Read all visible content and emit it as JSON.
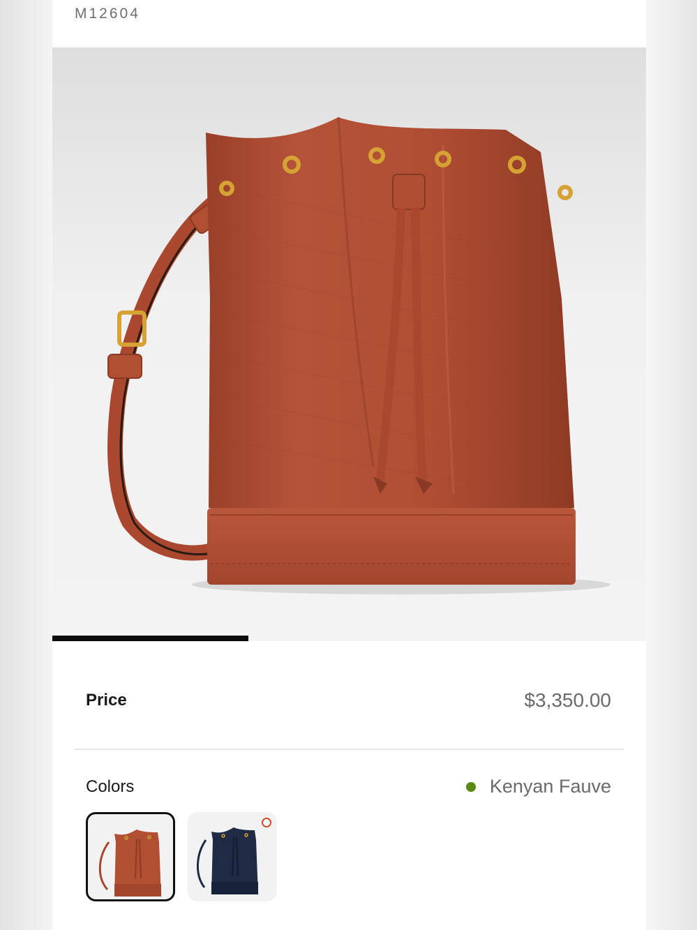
{
  "product": {
    "sku": "M12604",
    "hero_image": "bucket-bag-kenyan-fauve-photo",
    "gallery_progress": 0.33
  },
  "price": {
    "label": "Price",
    "value": "$3,350.00"
  },
  "colors": {
    "label": "Colors",
    "selected": "Kenyan Fauve",
    "selected_dot_color": "#5b8a14",
    "swatches": [
      {
        "name": "Kenyan Fauve",
        "color": "#b14f33",
        "selected": true
      },
      {
        "name": "Navy",
        "color": "#1f2a44",
        "selected": false,
        "badge": true
      }
    ]
  },
  "theme": {
    "bag_color": "#b14f33",
    "hardware_color": "#d6a233",
    "progress_color": "#0b0b0b"
  }
}
